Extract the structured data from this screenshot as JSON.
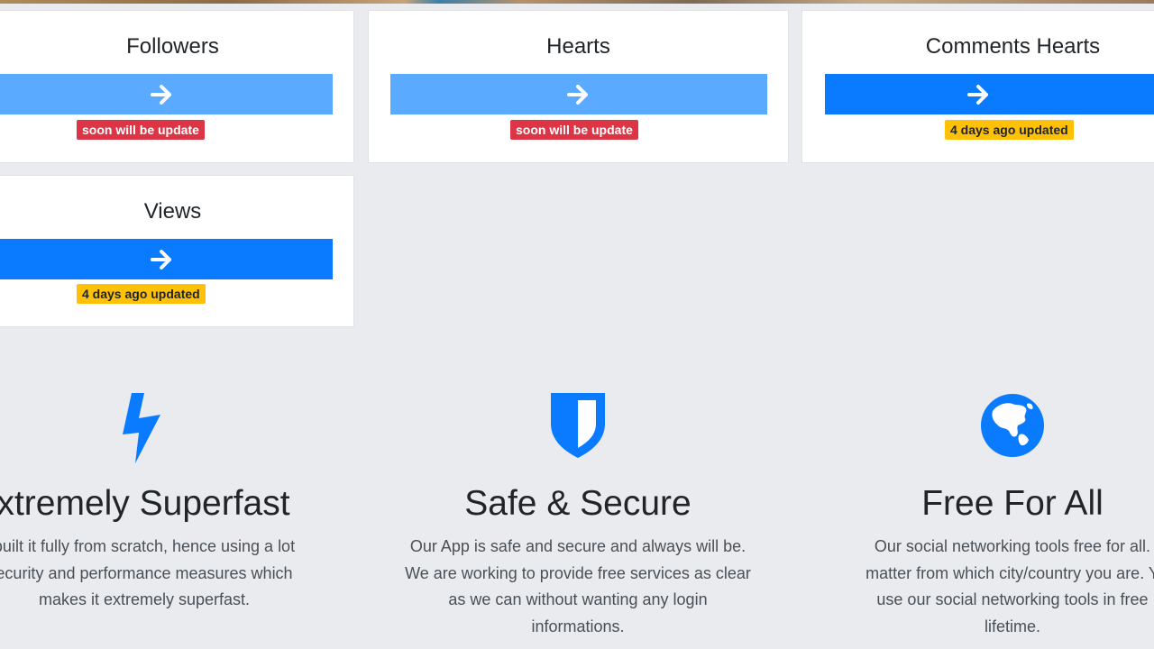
{
  "cards": [
    {
      "title": "Followers",
      "badge": "soon will be update",
      "badge_type": "danger",
      "button_style": "light"
    },
    {
      "title": "Hearts",
      "badge": "soon will be update",
      "badge_type": "danger",
      "button_style": "light"
    },
    {
      "title": "Comments Hearts",
      "badge": "4 days ago updated",
      "badge_type": "warning",
      "button_style": "solid"
    },
    {
      "title": "Views",
      "badge": "4 days ago updated",
      "badge_type": "warning",
      "button_style": "solid"
    }
  ],
  "features": [
    {
      "icon": "lightning-icon",
      "title": "xtremely Superfast",
      "lines": [
        "built it fully from scratch, hence using a lot",
        "ecurity and performance measures which",
        "makes it extremely superfast."
      ]
    },
    {
      "icon": "shield-icon",
      "title": "Safe & Secure",
      "lines": [
        "Our App is safe and secure and always will be.",
        "We are working to provide free services as clear",
        "as we can without wanting any login",
        "informations."
      ]
    },
    {
      "icon": "globe-icon",
      "title": "Free For All",
      "lines": [
        "Our social networking tools free for all.",
        "matter from which city/country you are. Y",
        "use our social networking tools in free",
        "lifetime."
      ]
    }
  ],
  "colors": {
    "page_bg": "#e9ebee",
    "button_light": "#5aabff",
    "button_solid": "#0a7bff",
    "badge_danger": "#dc3545",
    "badge_warning": "#ffc107",
    "icon_blue": "#0a7bff"
  }
}
